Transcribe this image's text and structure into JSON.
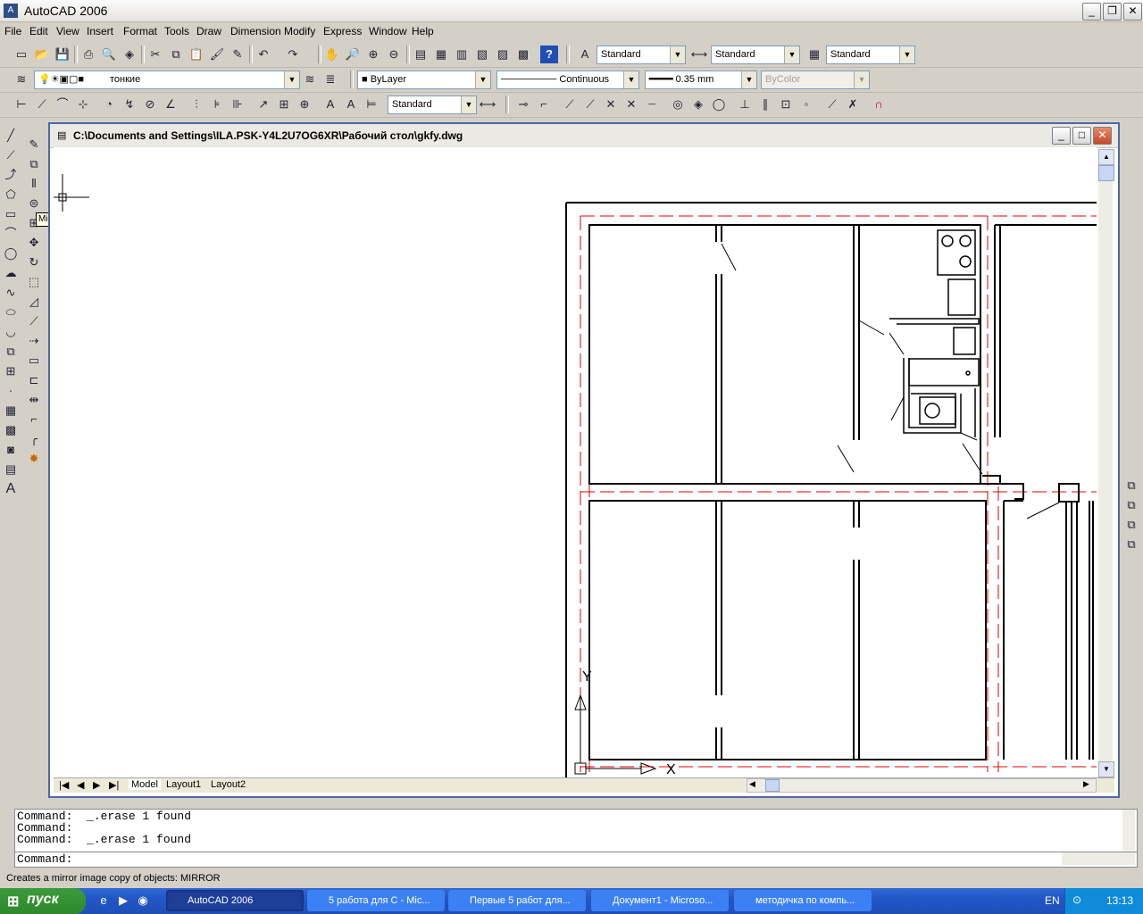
{
  "app": {
    "title": "AutoCAD 2006"
  },
  "menu": [
    "File",
    "Edit",
    "View",
    "Insert",
    "Format",
    "Tools",
    "Draw",
    "Dimension",
    "Modify",
    "Express",
    "Window",
    "Help"
  ],
  "toolbar_styles": {
    "text_style": "Standard",
    "dim_style": "Standard",
    "table_style": "Standard"
  },
  "layers": {
    "current_layer": "тонкие",
    "color": "ByLayer",
    "linetype": "Continuous",
    "lineweight": "0.35 mm",
    "plot_style": "ByColor"
  },
  "dim_toolbar": {
    "dim_style": "Standard"
  },
  "tooltip": "Mirror",
  "drawing": {
    "path": "C:\\Documents and Settings\\ILA.PSK-Y4L2U7OG6XR\\Рабочий стол\\gkfy.dwg",
    "tabs": [
      "Model",
      "Layout1",
      "Layout2"
    ],
    "ucs_x": "X",
    "ucs_y": "Y"
  },
  "command": {
    "history": [
      "Command:  _.erase 1 found",
      "Command:",
      "Command:  _.erase 1 found"
    ],
    "prompt": "Command:"
  },
  "status_text": "Creates a mirror image copy of objects:  MIRROR",
  "taskbar": {
    "start": "пуск",
    "items": [
      "AutoCAD 2006",
      "5 работа для С - Mic...",
      "Первые 5 работ для...",
      "Документ1 - Microso...",
      "методичка по компь..."
    ],
    "lang": "EN",
    "clock": "13:13"
  },
  "colors": {
    "xp_blue": "#2257c7",
    "start_green": "#2e8a2c",
    "axis_red": "#e00000"
  }
}
